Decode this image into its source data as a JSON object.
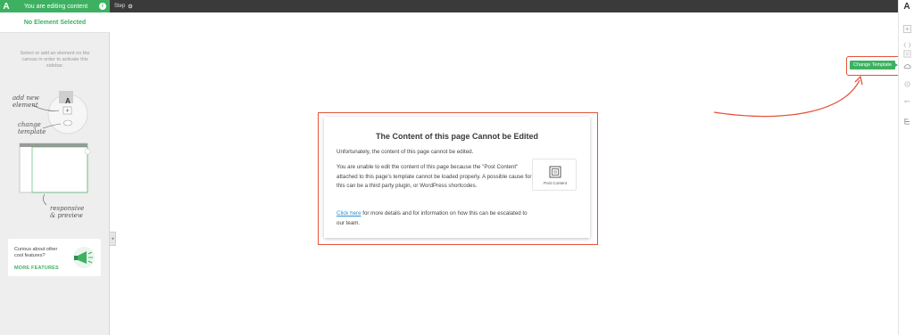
{
  "topbar": {
    "logo": "A",
    "editing_label": "You are editing content",
    "info_icon": "i",
    "step_label": "Step"
  },
  "sidebar": {
    "no_element_title": "No Element Selected",
    "hint": "Select or add an element on the canvas in order to activate this sidebar.",
    "illustration": {
      "add_new_element": [
        "add new",
        "element"
      ],
      "change_template": [
        "change",
        "template"
      ],
      "responsive_preview": [
        "responsive",
        "& preview"
      ]
    },
    "promo": {
      "text": "Curious about other cool features?",
      "link": "MORE FEATURES"
    },
    "collapse_glyph": "◂"
  },
  "rail": {
    "logo": "A",
    "icons": [
      "add-icon",
      "code-icon",
      "add-page-icon",
      "template-cloud-icon",
      "settings-icon",
      "undo-redo-icon",
      "hierarchy-icon"
    ]
  },
  "change_template_tooltip": "Change Template",
  "dialog": {
    "title": "The Content of this page Cannot be Edited",
    "p1": "Unfortunately, the content of this page cannot be edited.",
    "p2": "You are unable to edit the content of this page because the \"Post Content\" attached to this page's template cannot be loaded properly. A possible cause for this can be a third party plugin, or WordPress shortcodes.",
    "p3_link": "Click here",
    "p3_rest": " for more details and for information on how this can be escalated to our team.",
    "post_content_label": "Post Content"
  },
  "colors": {
    "accent_green": "#3db161",
    "highlight_red": "#e6523a",
    "topbar_dark": "#3a3a3a"
  }
}
